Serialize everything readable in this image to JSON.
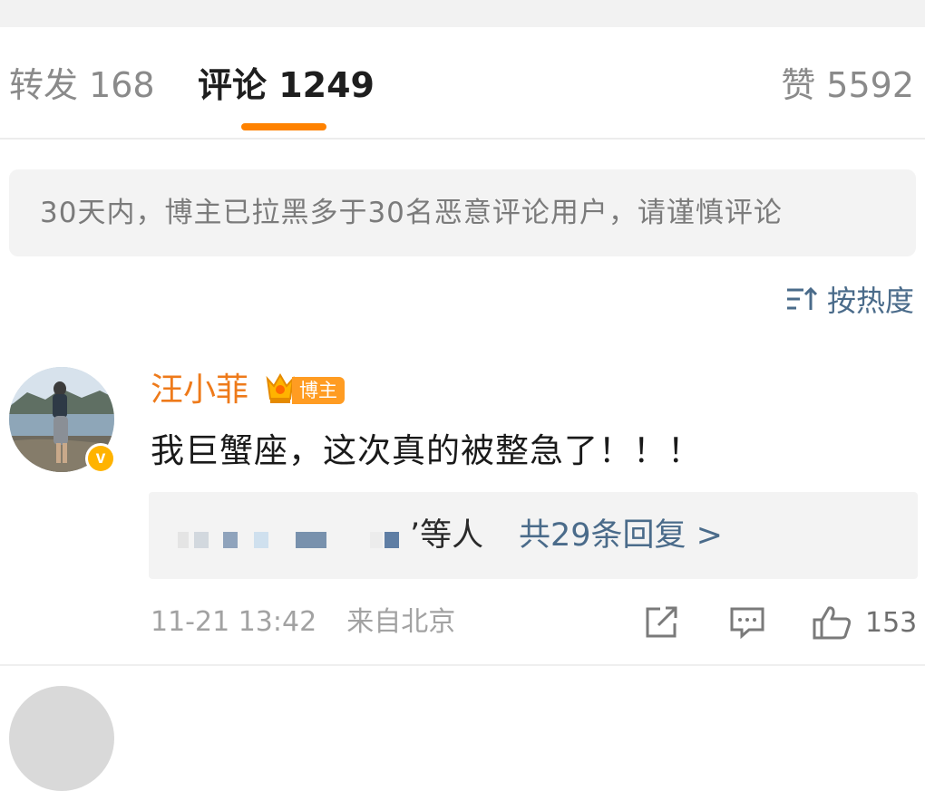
{
  "tabs": {
    "reposts": "转发 168",
    "comments": "评论 1249",
    "likes": "赞 5592"
  },
  "colors": {
    "accent_orange": "#ff8200",
    "link_blue": "#4a6b8a",
    "username_orange": "#ee7a1a",
    "badge_orange": "#ff9c22",
    "verified_yellow": "#ffb300"
  },
  "notice": "30天内，博主已拉黑多于30名恶意评论用户，请谨慎评论",
  "sort": {
    "label": "按热度",
    "icon": "sort-lines-arrow-icon"
  },
  "comment": {
    "username": "汪小菲",
    "badge": "博主",
    "badge_icon": "crown-icon",
    "verified_icon": "verified-v-icon",
    "verified_mark": "v",
    "text": "我巨蟹座，这次真的被整急了！！！",
    "replies_suffix": "’等人",
    "replies_link": "共29条回复 >",
    "time": "11-21 13:42",
    "location": "来自北京",
    "like_count": "153"
  }
}
